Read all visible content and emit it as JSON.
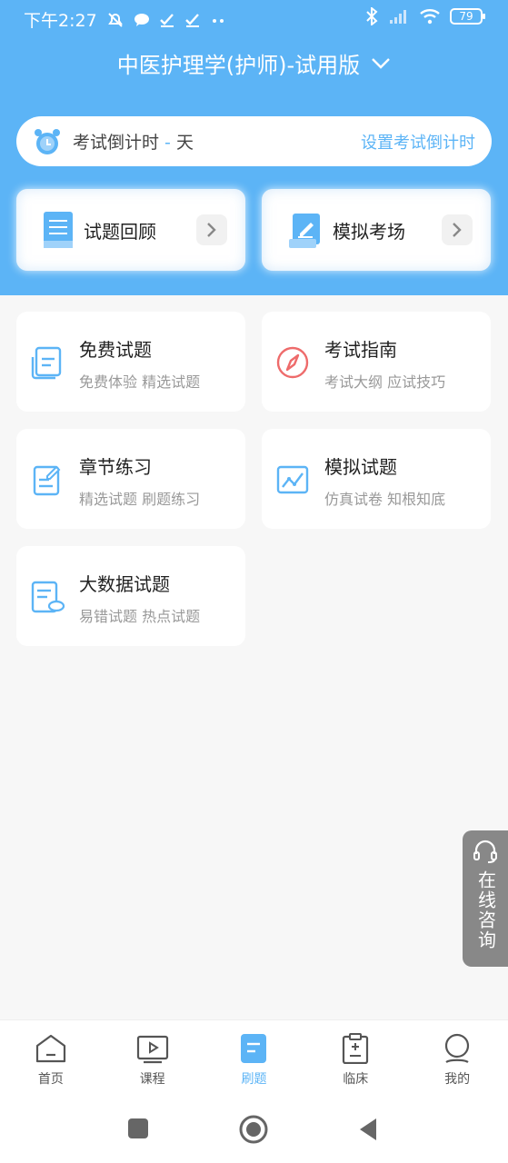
{
  "status_bar": {
    "time": "下午2:27",
    "battery": "79"
  },
  "header": {
    "title": "中医护理学(护师)-试用版"
  },
  "countdown": {
    "label_prefix": "考试倒计时",
    "dash": " - ",
    "unit": "天",
    "set_link": "设置考试倒计时"
  },
  "quick_cards": [
    {
      "label": "试题回顾"
    },
    {
      "label": "模拟考场"
    }
  ],
  "modules": [
    {
      "title": "免费试题",
      "subtitle": "免费体验 精选试题"
    },
    {
      "title": "考试指南",
      "subtitle": "考试大纲 应试技巧"
    },
    {
      "title": "章节练习",
      "subtitle": "精选试题 刷题练习"
    },
    {
      "title": "模拟试题",
      "subtitle": "仿真试卷 知根知底"
    },
    {
      "title": "大数据试题",
      "subtitle": "易错试题 热点试题"
    }
  ],
  "consult": {
    "label": "在线咨询"
  },
  "bottom_nav": [
    {
      "label": "首页"
    },
    {
      "label": "课程"
    },
    {
      "label": "刷题"
    },
    {
      "label": "临床"
    },
    {
      "label": "我的"
    }
  ],
  "colors": {
    "accent": "#5cb4f6",
    "icon_red": "#ee6b6b",
    "nav_gray": "#555555"
  }
}
